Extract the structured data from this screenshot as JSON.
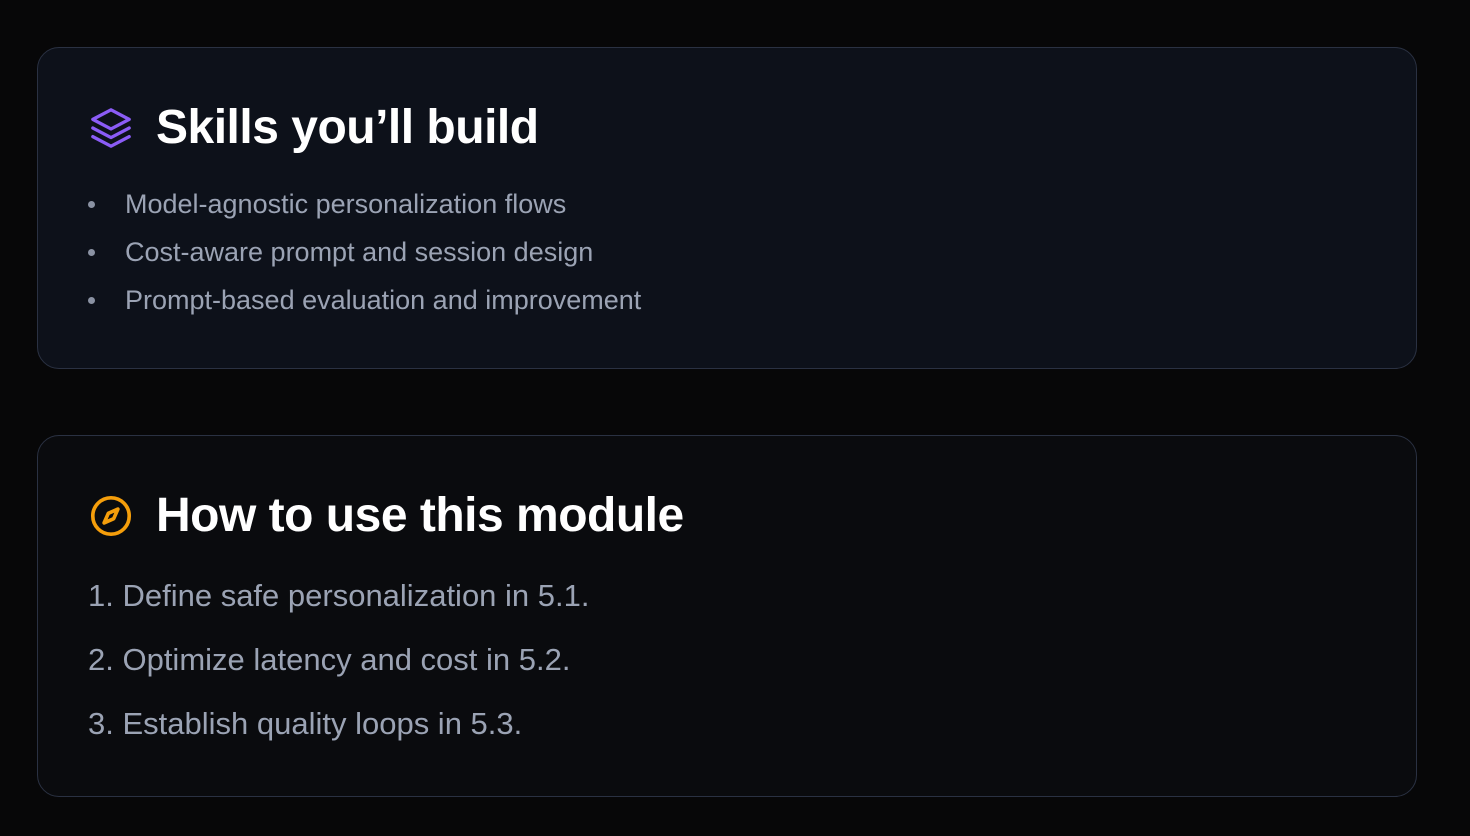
{
  "skills": {
    "title": "Skills you’ll build",
    "icon": "layers-icon",
    "icon_color": "#8b5cf6",
    "items": [
      "Model-agnostic personalization flows",
      "Cost-aware prompt and session design",
      "Prompt-based evaluation and improvement"
    ]
  },
  "howto": {
    "title": "How to use this module",
    "icon": "compass-icon",
    "icon_color": "#f59e0b",
    "steps": [
      "1. Define safe personalization in 5.1.",
      "2. Optimize latency and cost in 5.2.",
      "3. Establish quality loops in 5.3."
    ]
  }
}
